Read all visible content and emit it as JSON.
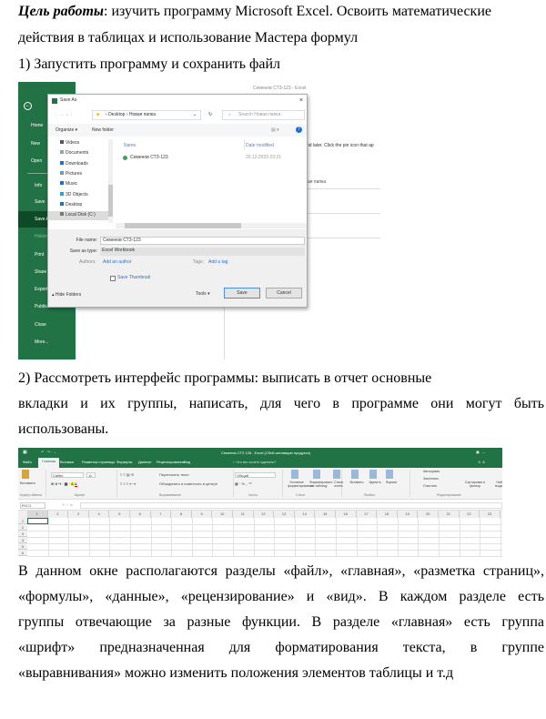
{
  "intro": {
    "label": "Цель работы",
    "text": ": изучить программу Microsoft Excel. Освоить математические",
    "line2": "действия в таблицах и использование Мастера формул"
  },
  "step1": "1) Запустить программу и сохранить файл",
  "step2": {
    "line1": "2) Рассмотреть интерфейс программы: выписать в отчет основные",
    "line2": "вкладки и их группы, написать, для чего в программе они могут быть",
    "line3": "использованы."
  },
  "paragraph": [
    "В данном окне располагаются разделы «файл», «главная», «разметка страниц»,",
    "«формулы», «данные», «рецензирование» и «вид». В каждом разделе есть",
    "группы отвечающие за разные функции. В разделе «главная» есть группа",
    "«шрифт» предназначенная для форматирования текста, в группе",
    "«выравнивания» можно изменить положения элементов таблицы и т.д"
  ],
  "screenshot1": {
    "window_title": "Семенов СТЗ-123 - Excel",
    "backstage": [
      "Home",
      "New",
      "Open",
      "Info",
      "Save",
      "Save As",
      "History",
      "Print",
      "Share",
      "Export",
      "Publish",
      "Close",
      "More..."
    ],
    "hint": "nd later. Click the pin icon that ap",
    "folder_frag": "ая папка",
    "dialog": {
      "title": "Save As",
      "path": [
        "Desktop",
        "Новая папка"
      ],
      "search_placeholder": "Search Новая папка",
      "organize": "Organize ▾",
      "new_folder": "New folder",
      "nav": [
        "Videos",
        "Documents",
        "Downloads",
        "Pictures",
        "Music",
        "3D Objects",
        "Desktop",
        "Local Disk (C:)"
      ],
      "col_name": "Name",
      "col_date": "Date modified",
      "files": [
        {
          "name": "Семенов СТЗ-123",
          "date": "20.12.2023 23:21"
        }
      ],
      "file_name_label": "File name:",
      "file_name": "Семенов СТЗ-123",
      "type_label": "Save as type:",
      "type": "Excel Workbook",
      "authors_label": "Authors:",
      "authors": "Add an author",
      "tags_label": "Tags:",
      "tags": "Add a tag",
      "thumbnail": "Save Thumbnail",
      "hide_folders": "Hide Folders",
      "tools": "Tools",
      "save": "Save",
      "cancel": "Cancel"
    }
  },
  "screenshot2": {
    "title": "Семенов СТЗ 128 - Excel (Сбой активации продукта)",
    "tabs": [
      "Файл",
      "Главная",
      "Вставка",
      "Разметка страницы",
      "Формулы",
      "Данные",
      "Рецензирование",
      "Вид"
    ],
    "tell_me": "Что вы хотите сделать?",
    "groups": [
      "Буфер обмена",
      "Шрифт",
      "Выравнивание",
      "Число",
      "Стили",
      "Ячейки",
      "Редактирование"
    ],
    "paste": "Вставить",
    "font": "Calibri",
    "size": "11",
    "wrap": "Переносить текст",
    "merge": "Объединить и поместить в центре",
    "number_format": "Общий",
    "styles": [
      "Условное форматирование",
      "Форматировать как таблицу",
      "Стили ячеек"
    ],
    "cells": [
      "Вставить",
      "Удалить",
      "Формат"
    ],
    "editing": [
      "Автосумма",
      "Заполнить",
      "Очистить",
      "Сортировка и фильтр",
      "Найти и выделить"
    ],
    "name_box": "R1C1",
    "columns": [
      "1",
      "2",
      "3",
      "4",
      "5",
      "6",
      "7",
      "8",
      "9",
      "10",
      "11",
      "12",
      "13",
      "14",
      "15",
      "16",
      "17",
      "18",
      "19",
      "20",
      "21",
      "22",
      "23"
    ],
    "rows": [
      "1",
      "2",
      "3",
      "4",
      "5",
      "6"
    ]
  },
  "colors": {
    "excel_green": "#217346",
    "dark_green": "#0e4a28",
    "link_blue": "#2f6fd0"
  }
}
